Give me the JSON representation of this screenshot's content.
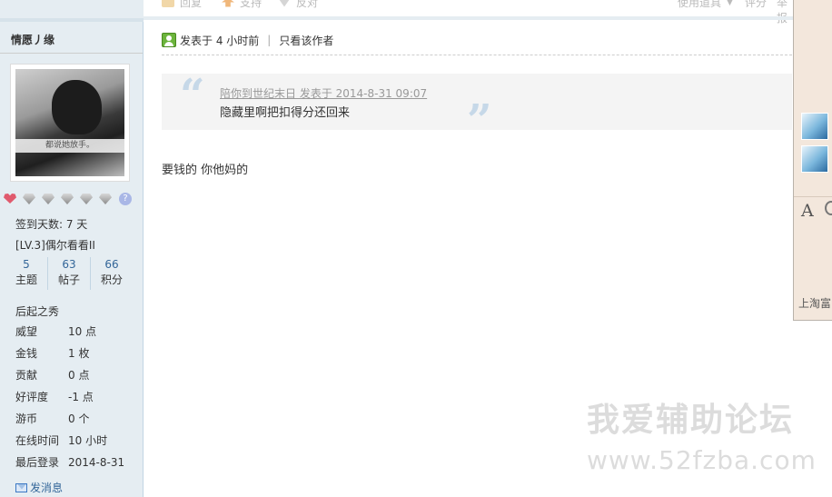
{
  "toolbar": {
    "reply": "回复",
    "support": "支持",
    "oppose": "反对",
    "use_tool": "使用道具",
    "rate": "评分",
    "report": "举报"
  },
  "user": {
    "name": "情愿丿缘",
    "avatar_caption": "都说她放手。",
    "checkin": "签到天数: 7 天",
    "level": "[LV.3]偶尔看看II",
    "stats": [
      {
        "value": "5",
        "label": "主题"
      },
      {
        "value": "63",
        "label": "帖子"
      },
      {
        "value": "66",
        "label": "积分"
      }
    ],
    "group": "后起之秀",
    "details": [
      {
        "label": "威望",
        "value": "10 点"
      },
      {
        "label": "金钱",
        "value": "1 枚"
      },
      {
        "label": "贡献",
        "value": "0 点"
      },
      {
        "label": "好评度",
        "value": "-1 点"
      },
      {
        "label": "游币",
        "value": "0 个"
      },
      {
        "label": "在线时间",
        "value": "10 小时"
      },
      {
        "label": "最后登录",
        "value": "2014-8-31"
      }
    ],
    "send_message": "发消息"
  },
  "post": {
    "posted": "发表于 4 小时前",
    "only_author": "只看该作者",
    "quote_link": "陪你到世纪末日 发表于 2014-8-31 09:07",
    "quote_text": "隐藏里啊把扣得分还回来",
    "body": "要钱的  你他妈的"
  },
  "watermark": {
    "cn": "我爱辅助论坛",
    "url": "www.52fzba.com"
  },
  "right_panel": {
    "font_glyph": "A",
    "footer": "上淘富"
  },
  "colors": {
    "sidebar_bg": "#e5edf2",
    "link": "#336699",
    "quote_bg": "#f4f4f4",
    "panel_bg": "#f3e7dc"
  }
}
